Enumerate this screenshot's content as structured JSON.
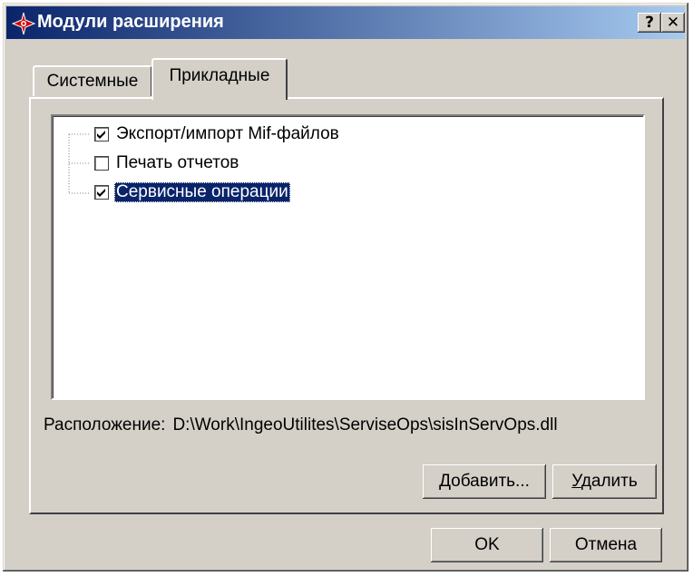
{
  "window": {
    "title": "Модули расширения",
    "help_label": "?",
    "close_label": "✕"
  },
  "tabs": [
    {
      "label": "Системные",
      "active": false
    },
    {
      "label": "Прикладные",
      "active": true
    }
  ],
  "tree": {
    "items": [
      {
        "label": "Экспорт/импорт Mif-файлов",
        "checked": true,
        "selected": false
      },
      {
        "label": "Печать отчетов",
        "checked": false,
        "selected": false
      },
      {
        "label": "Сервисные операции",
        "checked": true,
        "selected": true
      }
    ]
  },
  "location": {
    "label": "Расположение:",
    "value": "D:\\Work\\IngeoUtilites\\ServiseOps\\sisInServOps.dll"
  },
  "buttons": {
    "add": {
      "mnemonic": "Д",
      "rest": "обавить..."
    },
    "delete": {
      "mnemonic": "У",
      "rest": "далить"
    },
    "ok": "OK",
    "cancel": "Отмена"
  },
  "colors": {
    "titlebar_start": "#0a246a",
    "titlebar_end": "#a6caf0",
    "face": "#d4d0c8",
    "selection": "#0a246a",
    "app_icon": "#d40000"
  }
}
